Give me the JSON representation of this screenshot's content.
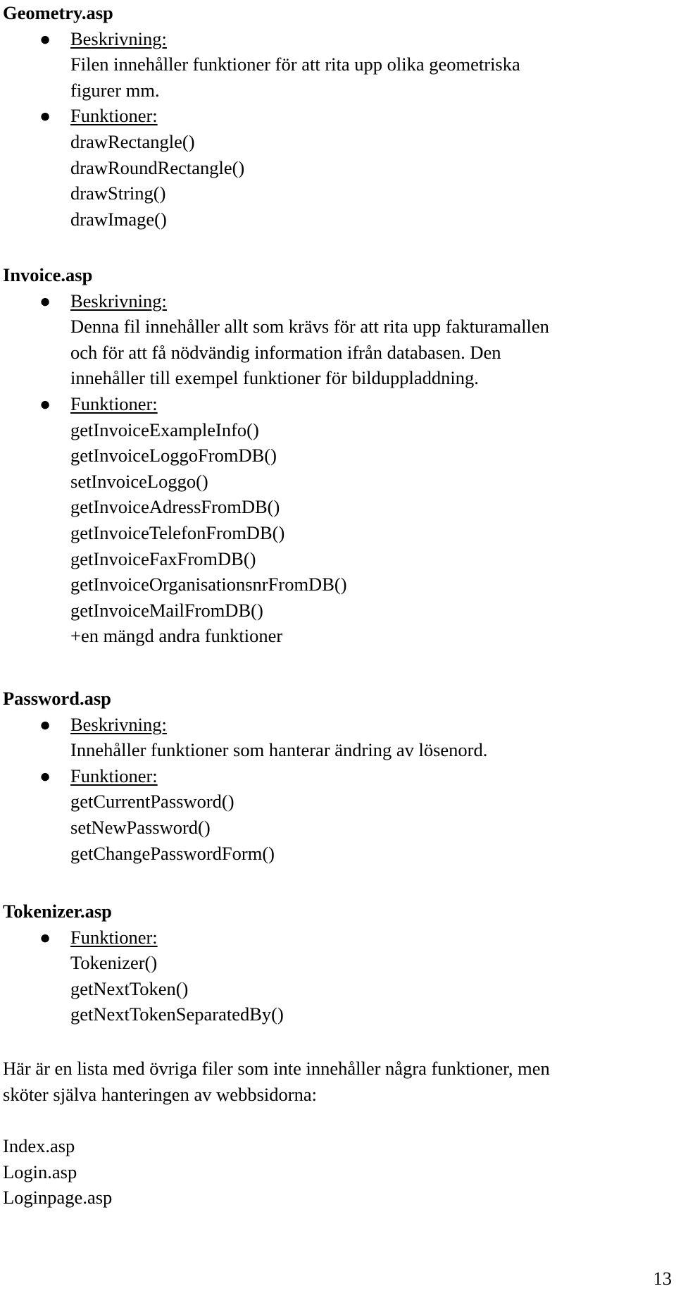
{
  "sections": [
    {
      "title": "Geometry.asp",
      "description_label": "Beskrivning:",
      "description_lines": [
        "Filen innehåller funktioner för att rita upp olika geometriska",
        "figurer mm."
      ],
      "functions_label": "Funktioner:",
      "functions": [
        "drawRectangle()",
        "drawRoundRectangle()",
        "drawString()",
        "drawImage()"
      ]
    },
    {
      "title": "Invoice.asp",
      "description_label": "Beskrivning:",
      "description_lines": [
        "Denna fil innehåller allt som krävs för att rita upp fakturamallen",
        "och för att få nödvändig information ifrån databasen. Den",
        "innehåller till exempel funktioner för bilduppladdning."
      ],
      "functions_label": "Funktioner:",
      "functions": [
        "getInvoiceExampleInfo()",
        "getInvoiceLoggoFromDB()",
        "setInvoiceLoggo()",
        "getInvoiceAdressFromDB()",
        "getInvoiceTelefonFromDB()",
        "getInvoiceFaxFromDB()",
        "getInvoiceOrganisationsnrFromDB()",
        "getInvoiceMailFromDB()",
        "+en mängd andra funktioner"
      ]
    },
    {
      "title": "Password.asp",
      "description_label": "Beskrivning:",
      "description_lines": [
        "Innehåller funktioner som hanterar ändring av lösenord."
      ],
      "functions_label": "Funktioner:",
      "functions": [
        "getCurrentPassword()",
        "setNewPassword()",
        "getChangePasswordForm()"
      ]
    },
    {
      "title": "Tokenizer.asp",
      "functions_label": "Funktioner:",
      "functions": [
        "Tokenizer()",
        "getNextToken()",
        "getNextTokenSeparatedBy()"
      ]
    }
  ],
  "other_files": {
    "intro_lines": [
      "Här är en lista med övriga filer som inte innehåller några funktioner, men",
      "sköter själva hanteringen av webbsidorna:"
    ],
    "files": [
      "Index.asp",
      "Login.asp",
      "Loginpage.asp"
    ]
  },
  "bullet_glyph": "●",
  "page_number": "13"
}
